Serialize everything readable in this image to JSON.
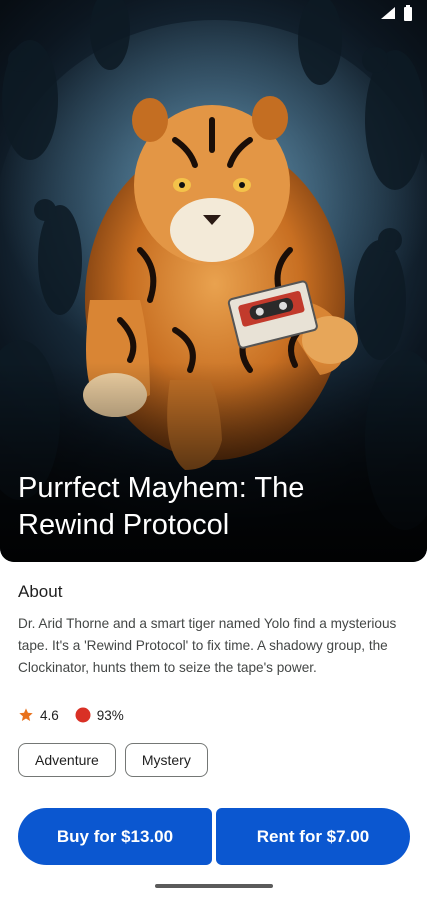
{
  "book": {
    "title": "Purrfect Mayhem: The Rewind Protocol",
    "cover_image": "tiger-with-cassette-cover-art"
  },
  "about": {
    "heading": "About",
    "description": "Dr. Arid Thorne and a smart tiger named Yolo find a mysterious tape. It's a 'Rewind Protocol' to fix time. A shadowy group, the Clockinator, hunts them to seize the tape's power."
  },
  "stats": {
    "rating": "4.6",
    "rating_icon": "star-icon",
    "score": "93%",
    "score_icon": "red-circle-icon"
  },
  "genres": [
    "Adventure",
    "Mystery"
  ],
  "actions": {
    "buy_label": "Buy for $13.00",
    "rent_label": "Rent for $7.00"
  },
  "colors": {
    "primary": "#0b57d0",
    "star": "#e8711c",
    "score": "#d93025"
  }
}
